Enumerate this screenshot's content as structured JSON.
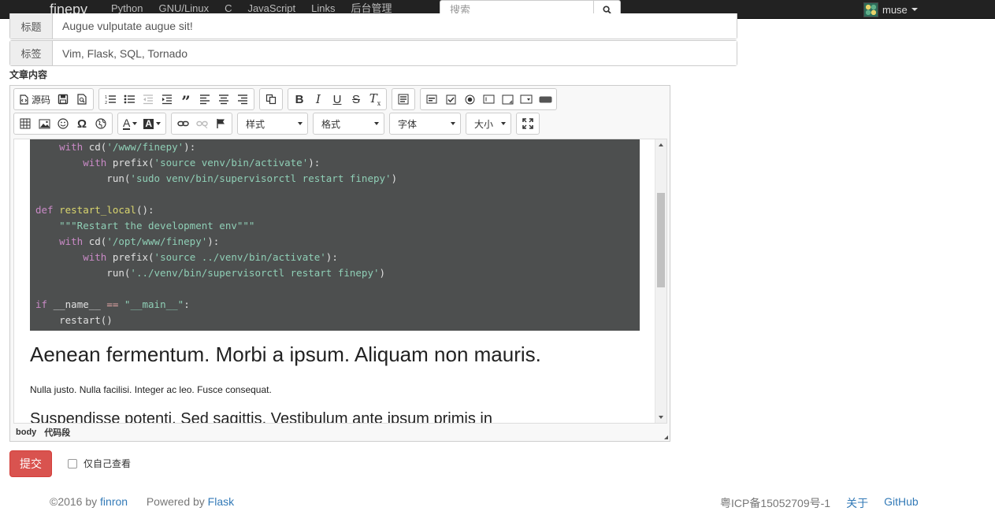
{
  "navbar": {
    "brand": "finepy",
    "links": [
      "Python",
      "GNU/Linux",
      "C",
      "JavaScript",
      "Links",
      "后台管理"
    ],
    "search_placeholder": "搜索",
    "user": "muse"
  },
  "form": {
    "title_label": "标题",
    "title_value": "Augue vulputate augue sit!",
    "tags_label": "标签",
    "tags_value": "Vim, Flask, SQL, Tornado",
    "content_label": "文章内容"
  },
  "editor": {
    "source_label": "源码",
    "combos": {
      "styles": "样式",
      "format": "格式",
      "font": "字体",
      "size": "大小"
    },
    "code_lines": [
      "    with cd('/www/finepy'):",
      "        with prefix('source venv/bin/activate'):",
      "            run('sudo venv/bin/supervisorctl restart finepy')",
      "",
      "def restart_local():",
      "    \"\"\"Restart the development env\"\"\"",
      "    with cd('/opt/www/finepy'):",
      "        with prefix('source ../venv/bin/activate'):",
      "            run('../venv/bin/supervisorctl restart finepy')",
      "",
      "if __name__ == \"__main__\":",
      "    restart()"
    ],
    "heading": "Aenean fermentum. Morbi a ipsum. Aliquam non mauris.",
    "paragraph": "Nulla justo. Nulla facilisi. Integer ac leo. Fusce consequat.",
    "subheading": "Suspendisse potenti. Sed sagittis. Vestibulum ante ipsum primis in",
    "status_path": [
      "body",
      "代码段"
    ]
  },
  "actions": {
    "submit": "提交",
    "private_label": "仅自己查看",
    "private_checked": false
  },
  "footer": {
    "copyright": "©2016 by ",
    "author": "finron",
    "powered_prefix": "Powered by ",
    "powered_link": "Flask",
    "icp": "粤ICP备15052709号-1",
    "about": "关于",
    "github": "GitHub"
  },
  "colors": {
    "navbar_bg": "#222222",
    "code_bg": "#4d4f4f",
    "submit_bg": "#d9534f",
    "link": "#337ab7"
  }
}
